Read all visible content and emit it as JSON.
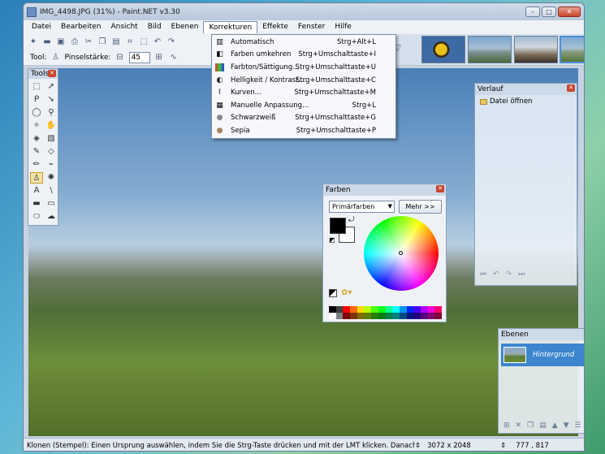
{
  "window": {
    "title": "IMG_4498.JPG (31%) - Paint.NET v3.30"
  },
  "menubar": {
    "items": [
      "Datei",
      "Bearbeiten",
      "Ansicht",
      "Bild",
      "Ebenen",
      "Korrekturen",
      "Effekte",
      "Fenster",
      "Hilfe"
    ],
    "active": "Korrekturen"
  },
  "toolbar": {
    "tool_label": "Tool:",
    "brush_label": "Pinselstärke:",
    "brush_value": "45"
  },
  "corrections_menu": [
    {
      "label": "Automatisch",
      "shortcut": "Strg+Alt+L",
      "icon": "auto-level-icon"
    },
    {
      "label": "Farben umkehren",
      "shortcut": "Strg+Umschalttaste+I",
      "icon": "invert-colors-icon"
    },
    {
      "label": "Farbton/Sättigung...",
      "shortcut": "Strg+Umschalttaste+U",
      "icon": "hue-saturation-icon"
    },
    {
      "label": "Helligkeit / Kontrast...",
      "shortcut": "Strg+Umschalttaste+C",
      "icon": "brightness-contrast-icon"
    },
    {
      "label": "Kurven...",
      "shortcut": "Strg+Umschalttaste+M",
      "icon": "curves-icon"
    },
    {
      "label": "Manuelle Anpassung...",
      "shortcut": "Strg+L",
      "icon": "levels-icon"
    },
    {
      "label": "Schwarzweiß",
      "shortcut": "Strg+Umschalttaste+G",
      "icon": "black-white-icon"
    },
    {
      "label": "Sepia",
      "shortcut": "Strg+Umschalttaste+P",
      "icon": "sepia-icon"
    }
  ],
  "tools_panel": {
    "title": "Tools"
  },
  "colors_panel": {
    "title": "Farben",
    "mode": "Primärfarben",
    "more_button": "Mehr >>",
    "primary_color": "#000000",
    "secondary_color": "#ffffff"
  },
  "history_panel": {
    "title": "Verlauf",
    "items": [
      "Datei öffnen"
    ]
  },
  "layers_panel": {
    "title": "Ebenen",
    "layers": [
      {
        "name": "Hintergrund",
        "visible": true
      }
    ]
  },
  "statusbar": {
    "hint": "Klonen (Stempel): Einen Ursprung auswählen, indem Sie die Strg-Taste drücken und mit der LMT klicken. Danach mit der LMT",
    "image_size": "3072 x 2048",
    "cursor_position": "777 , 817"
  }
}
